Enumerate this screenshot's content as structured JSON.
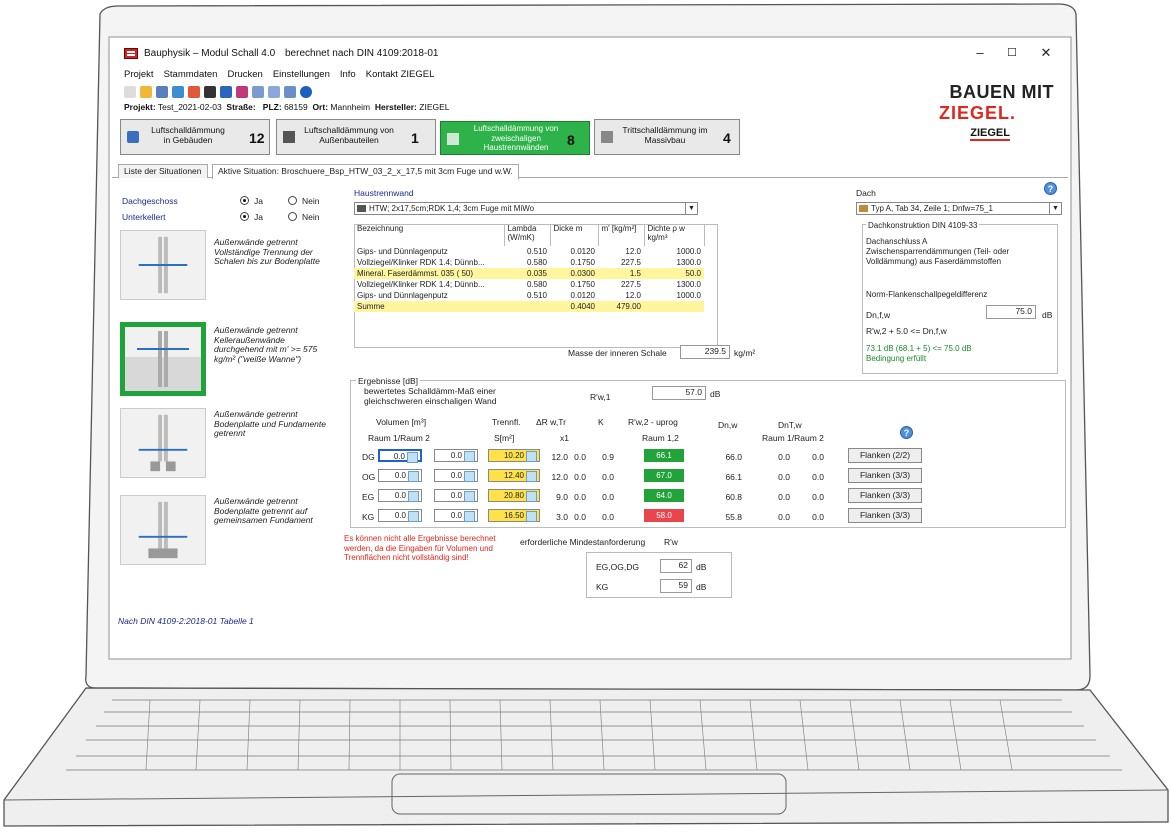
{
  "window": {
    "app_title": "Bauphysik – Modul Schall 4.0",
    "title_suffix": "berechnet nach DIN 4109:2018-01",
    "minimize": "–",
    "maximize": "☐",
    "close": "✕"
  },
  "menu": [
    "Projekt",
    "Stammdaten",
    "Drucken",
    "Einstellungen",
    "Info",
    "Kontakt ZIEGEL"
  ],
  "project_bar": {
    "projekt_label": "Projekt:",
    "projekt_value": "Test_2021-02-03",
    "strasse_label": "Straße:",
    "plz_label": "PLZ:",
    "plz_value": "68159",
    "ort_label": "Ort:",
    "ort_value": "Mannheim",
    "hersteller_label": "Hersteller:",
    "hersteller_value": "ZIEGEL"
  },
  "brand": {
    "line1": "BAUEN MIT",
    "line2": "ZIEGEL.",
    "logo": "ZIEGEL"
  },
  "module_tabs": [
    {
      "label1": "Luftschalldämmung",
      "label2": "in Gebäuden",
      "count": "12"
    },
    {
      "label1": "Luftschalldämmung von",
      "label2": "Außenbauteilen",
      "count": "1"
    },
    {
      "label1": "Luftschalldämmung von",
      "label2": "zweischaligen",
      "label3": "Haustrennwänden",
      "count": "8"
    },
    {
      "label1": "Trittschalldämmung im",
      "label2": "Massivbau",
      "count": "4"
    }
  ],
  "sub_tabs": {
    "list": "Liste der Situationen",
    "active": "Aktive Situation: Broschuere_Bsp_HTW_03_2_x_17,5 mit 3cm Fuge und w.W."
  },
  "left": {
    "dachgeschoss": "Dachgeschoss",
    "unterkellert": "Unterkellert",
    "ja": "Ja",
    "nein": "Nein",
    "variants": [
      "Außenwände getrennt Vollständige Trennung der Schalen bis zur Bodenplatte",
      "Außenwände getrennt Kelleraußenwände durchgehend mit m' >= 575 kg/m² (\"weiße Wanne\")",
      "Außenwände getrennt Bodenplatte und Fundamente getrennt",
      "Außenwände getrennt Bodenplatte getrennt auf gemeinsamen Fundament"
    ],
    "footnote": "Nach DIN 4109-2:2018-01 Tabelle 1"
  },
  "haustrennwand": {
    "title": "Haustrennwand",
    "selected": "HTW; 2x17,5cm;RDK 1,4; 3cm Fuge mit MiWo",
    "columns": [
      "Bezeichnung",
      "Lambda (W/mK)",
      "Dicke m",
      "m' [kg/m²]",
      "Dichte ρ w kg/m³"
    ],
    "rows": [
      [
        "Gips- und Dünnlagenputz",
        "0.510",
        "0.0120",
        "12.0",
        "1000.0"
      ],
      [
        "Vollziegel/Klinker RDK 1.4; Dünnb...",
        "0.580",
        "0.1750",
        "227.5",
        "1300.0"
      ],
      [
        "Mineral. Faserdämmst. 035 ( 50)",
        "0.035",
        "0.0300",
        "1.5",
        "50.0"
      ],
      [
        "Vollziegel/Klinker RDK 1.4; Dünnb...",
        "0.580",
        "0.1750",
        "227.5",
        "1300.0"
      ],
      [
        "Gips- und Dünnlagenputz",
        "0.510",
        "0.0120",
        "12.0",
        "1000.0"
      ]
    ],
    "sum": [
      "Summe",
      "",
      "0.4040",
      "479.00",
      ""
    ],
    "masse_label": "Masse der inneren Schale",
    "masse_value": "239.5",
    "masse_unit": "kg/m²"
  },
  "dach": {
    "title": "Dach",
    "selected": "Typ A, Tab 34, Zeile 1; Dnfw=75_1",
    "group": "Dachkonstruktion DIN 4109-33",
    "anschluss": "Dachanschluss A",
    "beschreibung": "Zwischensparrendämmungen (Teil- oder Volldämmung) aus Faserdämmstoffen",
    "norm_label": "Norm-Flankenschallpegeldifferenz",
    "dnfw_label": "Dn,f,w",
    "dnfw_value": "75.0",
    "dnfw_unit": "dB",
    "formula": "R'w,2  + 5.0  <= Dn,f,w",
    "result": "73.1 dB (68.1 + 5)  <= 75.0 dB",
    "status": "Bedingung erfüllt"
  },
  "ergebnisse": {
    "title": "Ergebnisse [dB]",
    "bewertet": "bewertetes Schalldämm-Maß einer gleichschweren einschaligen Wand",
    "rw1_label": "R'w,1",
    "rw1_value": "57.0",
    "rw1_unit": "dB",
    "col_volumen": "Volumen [m³]",
    "col_raum12": "Raum 1/Raum 2",
    "col_trennfl": "Trennfl.",
    "col_s": "S[m²]",
    "col_dr": "ΔR w,Tr",
    "col_x1": "x1",
    "col_k": "K",
    "col_rw2": "R'w,2 - uprog",
    "col_raum_1_2": "Raum 1,2",
    "col_dnw": "Dn,w",
    "col_dntw": "DnT,w",
    "col_raum1raum2": "Raum 1/Raum 2",
    "rows": [
      {
        "floor": "DG",
        "v1": "0.0",
        "v2": "0.0",
        "s": "10.20",
        "dr": "12.0",
        "x1": "0.0",
        "k": "0.9",
        "rw2": "66.1",
        "rw_color": "#21a33a",
        "dnw": "66.0",
        "d1": "0.0",
        "d2": "0.0",
        "flanken": "Flanken (2/2)"
      },
      {
        "floor": "OG",
        "v1": "0.0",
        "v2": "0.0",
        "s": "12.40",
        "dr": "12.0",
        "x1": "0.0",
        "k": "0.0",
        "rw2": "67.0",
        "rw_color": "#21a33a",
        "dnw": "66.1",
        "d1": "0.0",
        "d2": "0.0",
        "flanken": "Flanken (3/3)"
      },
      {
        "floor": "EG",
        "v1": "0.0",
        "v2": "0.0",
        "s": "20.80",
        "dr": "9.0",
        "x1": "0.0",
        "k": "0.0",
        "rw2": "64.0",
        "rw_color": "#21a33a",
        "dnw": "60.8",
        "d1": "0.0",
        "d2": "0.0",
        "flanken": "Flanken (3/3)"
      },
      {
        "floor": "KG",
        "v1": "0.0",
        "v2": "0.0",
        "s": "16.50",
        "dr": "3.0",
        "x1": "0.0",
        "k": "0.0",
        "rw2": "58.0",
        "rw_color": "#e8464c",
        "dnw": "55.8",
        "d1": "0.0",
        "d2": "0.0",
        "flanken": "Flanken (3/3)"
      }
    ],
    "warning": "Es können nicht alle Ergebnisse berechnet werden, da die Eingaben für Volumen und Trennflächen nicht vollständig sind!",
    "mindest_label": "erforderliche Mindestanforderung",
    "mindest_symbol": "R'w",
    "req_egogdg_label": "EG,OG,DG",
    "req_egogdg_value": "62",
    "req_kg_label": "KG",
    "req_kg_value": "59",
    "req_unit": "dB"
  },
  "colors": {
    "active_green": "#2db34a",
    "warn_red": "#e8464c",
    "highlight_yellow": "#fff59d",
    "brand_red": "#e1261c"
  }
}
